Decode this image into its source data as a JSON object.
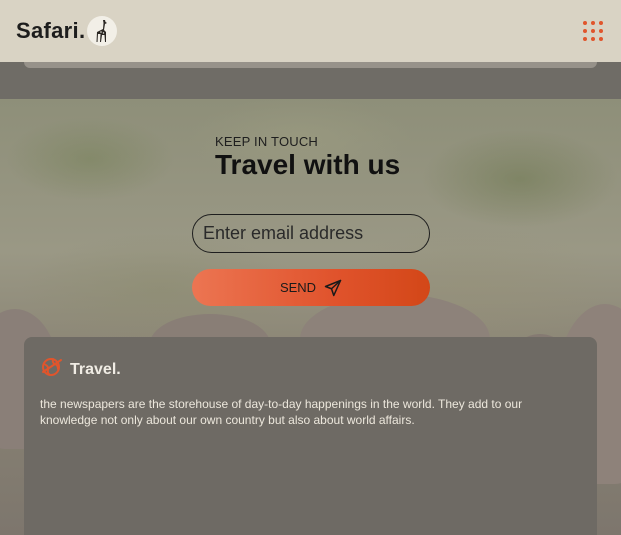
{
  "header": {
    "brand": "Safari."
  },
  "hero": {
    "kicker": "KEEP IN TOUCH",
    "title": "Travel with us",
    "email_placeholder": "Enter email address",
    "send_label": "SEND"
  },
  "footer": {
    "brand": "Travel.",
    "description": "the newspapers are the storehouse of day-to-day happenings in the world. They add to our knowledge not only about our own country but also about world affairs."
  },
  "colors": {
    "accent": "#e0552c",
    "header_bg": "#d9d3c4",
    "card_bg": "#6e6a64"
  },
  "icons": [
    "giraffe-icon",
    "menu-grid-icon",
    "send-icon",
    "travel-globe-icon"
  ]
}
